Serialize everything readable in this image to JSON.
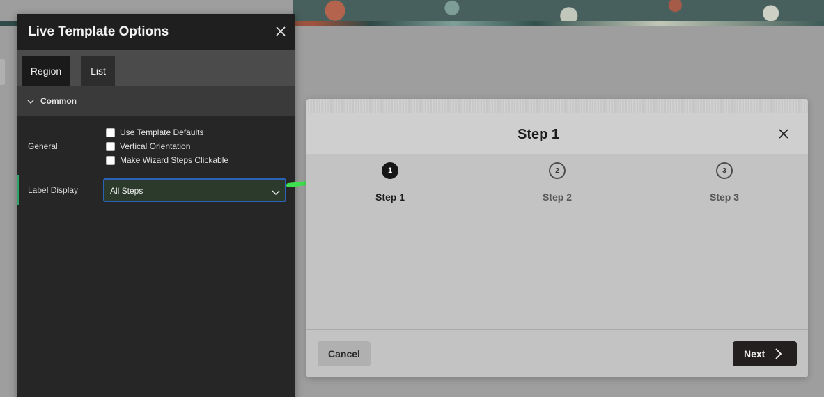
{
  "lto": {
    "title": "Live Template Options",
    "close_icon": "close-icon",
    "tabs": [
      {
        "label": "Region",
        "active": true
      },
      {
        "label": "List",
        "active": false
      }
    ],
    "section": {
      "label": "Common",
      "icon": "chevron-down-icon",
      "expanded": true
    },
    "general": {
      "label": "General",
      "checkboxes": [
        {
          "label": "Use Template Defaults",
          "checked": false
        },
        {
          "label": "Vertical Orientation",
          "checked": false
        },
        {
          "label": "Make Wizard Steps Clickable",
          "checked": false
        }
      ]
    },
    "label_display": {
      "label": "Label Display",
      "selected": "All Steps",
      "icon": "chevron-down-icon"
    }
  },
  "annotation": {
    "icon": "green-arrow-icon",
    "color": "#3ee04f"
  },
  "wizard": {
    "title": "Step 1",
    "close_icon": "close-icon",
    "steps": [
      {
        "number": "1",
        "label": "Step 1",
        "active": true
      },
      {
        "number": "2",
        "label": "Step 2",
        "active": false
      },
      {
        "number": "3",
        "label": "Step 3",
        "active": false
      }
    ],
    "cancel_label": "Cancel",
    "next_label": "Next",
    "next_icon": "chevron-right-icon"
  },
  "colors": {
    "overlay": "#9e9e9e",
    "panel": "#262626",
    "focus_border": "#2a62b8",
    "active_marker": "#2fa36a",
    "next_button": "#241f1f"
  }
}
